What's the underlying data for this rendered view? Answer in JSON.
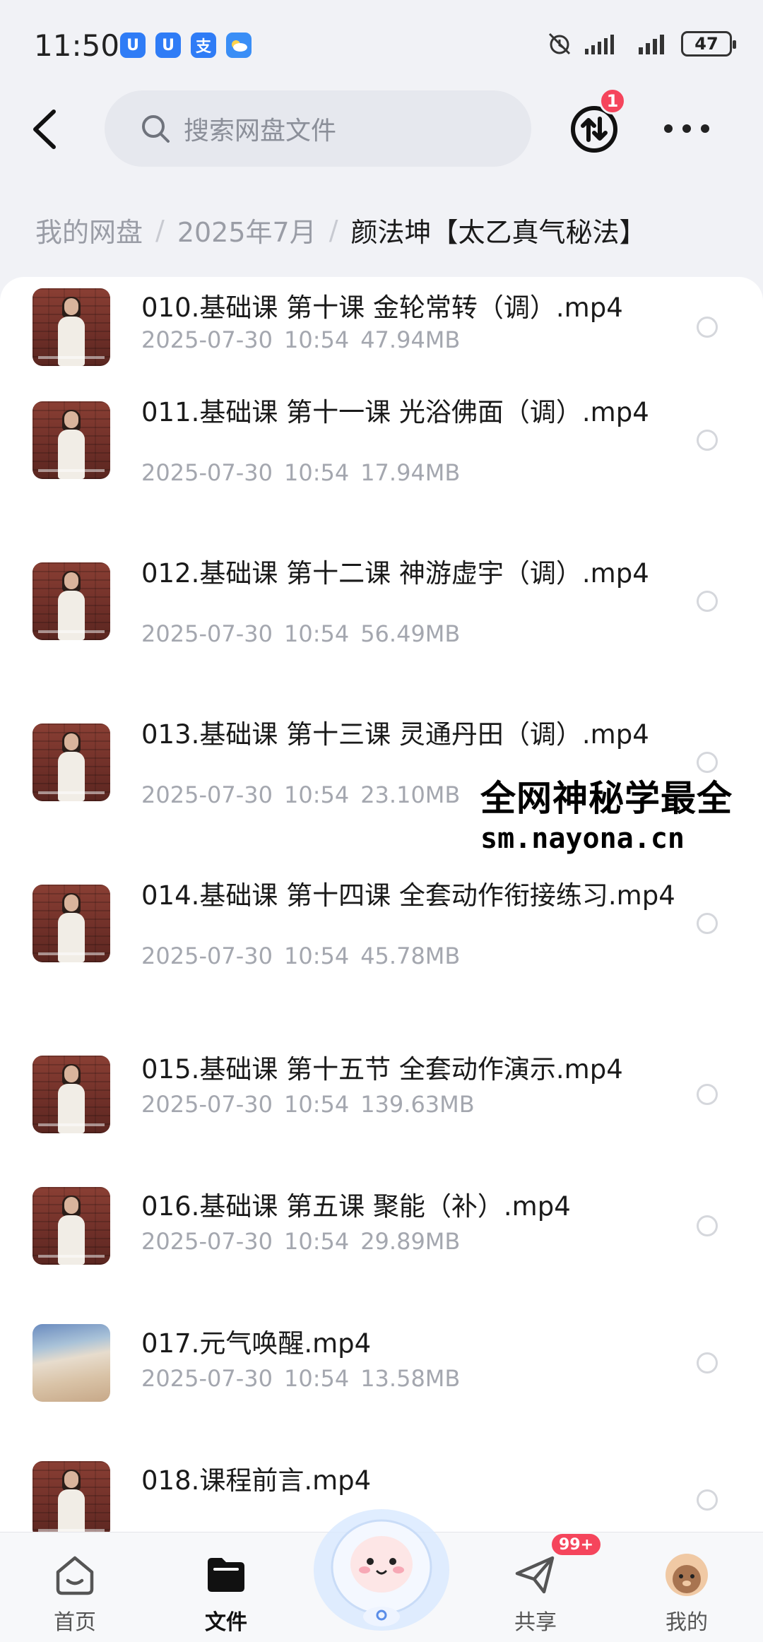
{
  "status_bar": {
    "time": "11:50",
    "app_icons": [
      "U",
      "U",
      "支",
      ""
    ],
    "battery": "47"
  },
  "search": {
    "placeholder": "搜索网盘文件"
  },
  "transfer_badge": "1",
  "breadcrumb": {
    "root": "我的网盘",
    "parent": "2025年7月",
    "current": "颜法坤【太乙真气秘法】"
  },
  "files": [
    {
      "name": "010.基础课 第十课 金轮常转（调）.mp4",
      "date": "2025-07-30",
      "time": "10:54",
      "size": "47.94MB",
      "thumb": "video"
    },
    {
      "name": "011.基础课 第十一课 光浴佛面（调）.mp4",
      "date": "2025-07-30",
      "time": "10:54",
      "size": "17.94MB",
      "thumb": "video"
    },
    {
      "name": "012.基础课 第十二课 神游虚宇（调）.mp4",
      "date": "2025-07-30",
      "time": "10:54",
      "size": "56.49MB",
      "thumb": "video"
    },
    {
      "name": "013.基础课 第十三课 灵通丹田（调）.mp4",
      "date": "2025-07-30",
      "time": "10:54",
      "size": "23.10MB",
      "thumb": "video"
    },
    {
      "name": "014.基础课 第十四课 全套动作衔接练习.mp4",
      "date": "2025-07-30",
      "time": "10:54",
      "size": "45.78MB",
      "thumb": "video"
    },
    {
      "name": "015.基础课 第十五节 全套动作演示.mp4",
      "date": "2025-07-30",
      "time": "10:54",
      "size": "139.63MB",
      "thumb": "video"
    },
    {
      "name": "016.基础课 第五课 聚能（补）.mp4",
      "date": "2025-07-30",
      "time": "10:54",
      "size": "29.89MB",
      "thumb": "video"
    },
    {
      "name": "017.元气唤醒.mp4",
      "date": "2025-07-30",
      "time": "10:54",
      "size": "13.58MB",
      "thumb": "desert"
    },
    {
      "name": "018.课程前言.mp4",
      "date": "",
      "time": "",
      "size": "",
      "thumb": "video"
    }
  ],
  "watermark": {
    "line1": "全网神秘学最全",
    "line2": "sm.nayona.cn"
  },
  "bottom_nav": {
    "home": "首页",
    "files": "文件",
    "share": "共享",
    "me": "我的",
    "share_badge": "99+"
  },
  "colors": {
    "accent": "#2f7cf6",
    "badge": "#f5455c",
    "muted_text": "#a4a7af"
  }
}
